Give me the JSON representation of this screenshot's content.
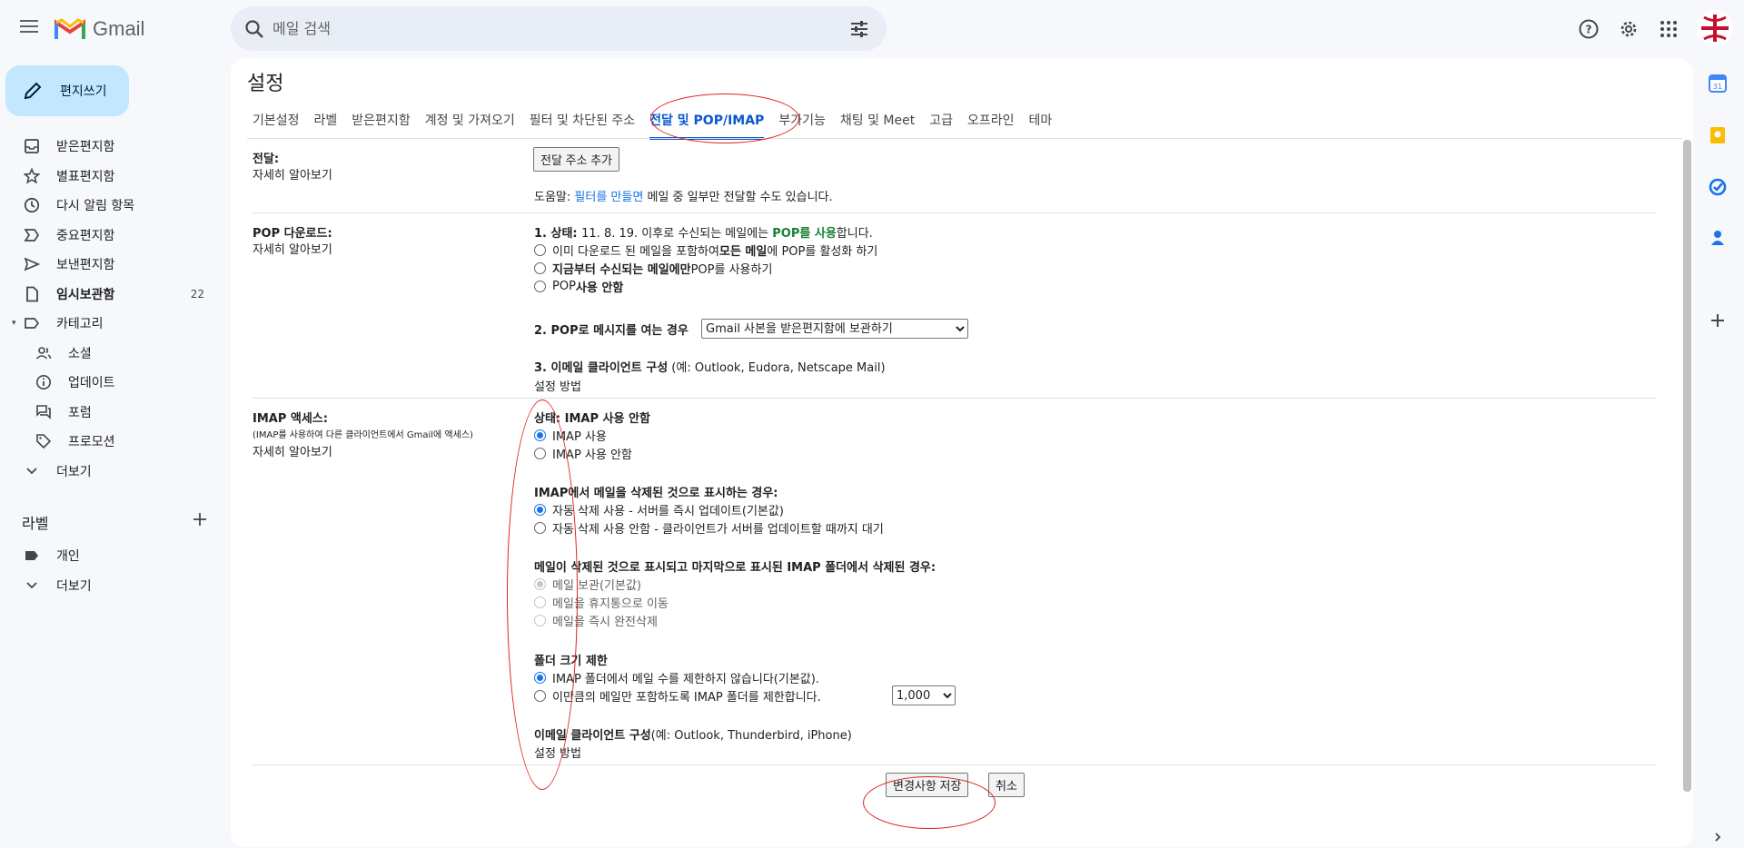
{
  "app": {
    "name": "Gmail"
  },
  "search": {
    "placeholder": "메일 검색"
  },
  "compose": {
    "label": "편지쓰기"
  },
  "nav": {
    "items": [
      {
        "label": "받은편지함",
        "icon": "inbox-icon"
      },
      {
        "label": "별표편지함",
        "icon": "star-icon"
      },
      {
        "label": "다시 알림 항목",
        "icon": "clock-icon"
      },
      {
        "label": "중요편지함",
        "icon": "important-icon"
      },
      {
        "label": "보낸편지함",
        "icon": "send-icon"
      },
      {
        "label": "임시보관함",
        "icon": "draft-icon",
        "count": "22"
      },
      {
        "label": "카테고리",
        "icon": "label-icon"
      },
      {
        "label": "소셜",
        "icon": "people-icon"
      },
      {
        "label": "업데이트",
        "icon": "info-icon"
      },
      {
        "label": "포럼",
        "icon": "forum-icon"
      },
      {
        "label": "프로모션",
        "icon": "tag-icon"
      },
      {
        "label": "더보기",
        "icon": "chevron-down-icon"
      }
    ],
    "labels_heading": "라벨",
    "labels": [
      {
        "label": "개인",
        "icon": "label-filled-icon"
      },
      {
        "label": "더보기",
        "icon": "chevron-down-icon"
      }
    ]
  },
  "settings": {
    "title": "설정",
    "tabs": [
      "기본설정",
      "라벨",
      "받은편지함",
      "계정 및 가져오기",
      "필터 및 차단된 주소",
      "전달 및 POP/IMAP",
      "부가기능",
      "채팅 및 Meet",
      "고급",
      "오프라인",
      "테마"
    ],
    "active_tab": "전달 및 POP/IMAP",
    "forwarding": {
      "title": "전달:",
      "learn_more": "자세히 알아보기",
      "add_button": "전달 주소 추가",
      "tip_prefix": "도움말: ",
      "tip_link": "필터를 만들면",
      "tip_suffix": " 메일 중 일부만 전달할 수도 있습니다."
    },
    "pop": {
      "title": "POP 다운로드:",
      "learn_more": "자세히 알아보기",
      "status_label": "1. 상태: ",
      "status_date": "11. 8. 19. 이후로 수신되는 메일에는 ",
      "status_on": "POP를 사용",
      "status_end": "합니다.",
      "options": [
        {
          "pre": "이미 다운로드 된 메일을 포함하여 ",
          "bold": "모든 메일",
          "post": "에 POP를 활성화 하기",
          "selected": false
        },
        {
          "pre": "",
          "bold": "지금부터 수신되는 메일에만",
          "post": " POP를 사용하기",
          "selected": false
        },
        {
          "pre": "POP ",
          "bold": "사용 안함",
          "post": "",
          "selected": false
        }
      ],
      "step2_bold": "2. POP",
      "step2_rest": "로 메시지를 여는 경우",
      "step2_select": "Gmail 사본을 받은편지함에 보관하기",
      "step3_bold": "3. 이메일 클라이언트 구성",
      "step3_rest": " (예: Outlook, Eudora, Netscape Mail)",
      "setup_link": "설정 방법"
    },
    "imap": {
      "title": "IMAP 액세스:",
      "subtitle": "(IMAP를 사용하여 다른 클라이언트에서 Gmail에 액세스)",
      "learn_more": "자세히 알아보기",
      "status": "상태: IMAP 사용 안함",
      "access_options": [
        {
          "label": "IMAP 사용",
          "selected": true
        },
        {
          "label": "IMAP 사용 안함",
          "selected": false
        }
      ],
      "delete_heading": "IMAP에서 메일을 삭제된 것으로 표시하는 경우:",
      "delete_options": [
        {
          "label": "자동 삭제 사용 - 서버를 즉시 업데이트(기본값)",
          "selected": true
        },
        {
          "label": "자동 삭제 사용 안함 - 클라이언트가 서버를 업데이트할 때까지 대기",
          "selected": false
        }
      ],
      "expunge_heading": "메일이 삭제된 것으로 표시되고 마지막으로 표시된 IMAP 폴더에서 삭제된 경우:",
      "expunge_options": [
        {
          "label": "메일 보관(기본값)",
          "selected": true
        },
        {
          "label": "메일을 휴지통으로 이동",
          "selected": false
        },
        {
          "label": "메일을 즉시 완전삭제",
          "selected": false
        }
      ],
      "folder_heading": "폴더 크기 제한",
      "folder_options": [
        {
          "label": "IMAP 폴더에서 메일 수를 제한하지 않습니다(기본값).",
          "selected": true
        },
        {
          "label": "이만큼의 메일만 포함하도록 IMAP 폴더를 제한합니다.",
          "selected": false
        }
      ],
      "folder_limit": "1,000",
      "client_bold": "이메일 클라이언트 구성",
      "client_rest": "(예: Outlook, Thunderbird, iPhone)",
      "setup_link": "설정 방법"
    },
    "save_button": "변경사항 저장",
    "cancel_button": "취소"
  },
  "colors": {
    "accent": "#0b57d0",
    "link": "#1a73e8",
    "compose_bg": "#c2e7ff",
    "annotation": "#e02020"
  }
}
